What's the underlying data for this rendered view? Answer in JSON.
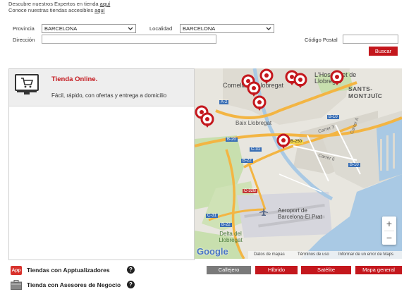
{
  "header": {
    "line1_prefix": "Descubre nuestros Expertos en tienda ",
    "line1_link": "aquí",
    "line2_prefix": "Conoce nuestras tiendas accesibles ",
    "line2_link": "aquí"
  },
  "form": {
    "provincia_label": "Provincia",
    "provincia_value": "BARCELONA",
    "localidad_label": "Localidad",
    "localidad_value": "BARCELONA",
    "direccion_label": "Dirección",
    "direccion_value": "",
    "codigo_postal_label": "Código Postal",
    "codigo_postal_value": "",
    "search_label": "Buscar"
  },
  "online_store": {
    "title": "Tienda Online.",
    "description": "Fácil, rápido, con ofertas y entrega a domicilio",
    "icon": "shopping-cart-monitor-icon"
  },
  "map": {
    "places": {
      "cornella": "Cornellà de Llobregat",
      "hospitalet": "L'Hospitalet de Llobregat",
      "sants": "SANTS-MONTJUÏC",
      "baix": "Baix Llobregat",
      "aeroport": "Aeroport de Barcelona-El Prat",
      "delta": "Delta del Llobregat",
      "carrer3": "Carrer 3",
      "carrer6": "Carrer 6",
      "carrera": "Carrer A"
    },
    "road_labels": [
      "A-2",
      "B-10",
      "B-10",
      "B-20",
      "C-31",
      "B-22",
      "B-250",
      "C-32B",
      "C-31",
      "B-22"
    ],
    "zoom_in": "+",
    "zoom_out": "−",
    "logo": "Google",
    "footer": {
      "data": "Datos de mapas",
      "terms": "Términos de uso",
      "report": "Informar de un error de Maps"
    },
    "tabs": [
      "Callejero",
      "Híbrido",
      "Satélite",
      "Mapa general"
    ]
  },
  "footer_links": {
    "apptualizadores": "Tiendas con Apptualizadores",
    "asesores": "Tienda con Asesores de Negocio",
    "app_badge": "App"
  },
  "colors": {
    "brand_red": "#c4171d",
    "tab_active": "#7a7a7a",
    "map_water": "#a9c9e4",
    "map_land": "#e8e6df"
  }
}
